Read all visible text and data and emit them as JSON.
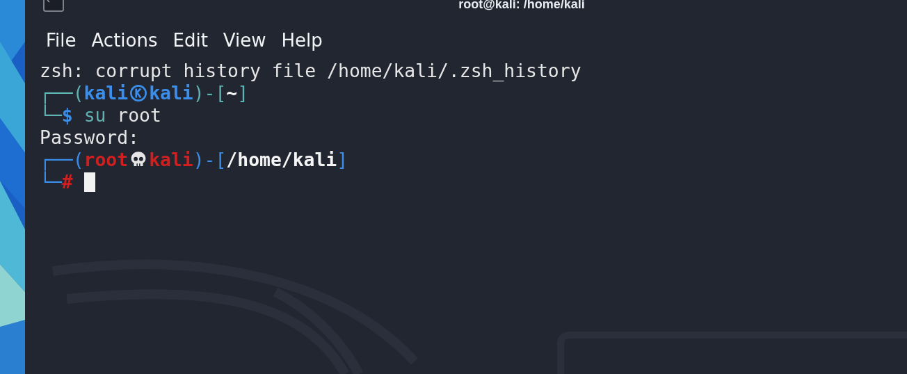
{
  "window": {
    "title": "root@kali: /home/kali"
  },
  "menu": [
    {
      "label": "File"
    },
    {
      "label": "Actions"
    },
    {
      "label": "Edit"
    },
    {
      "label": "View"
    },
    {
      "label": "Help"
    }
  ],
  "lines": [
    {
      "kind": "output",
      "text": "zsh: corrupt history file /home/kali/.zsh_history"
    },
    {
      "kind": "prompt",
      "root": false,
      "corner": "┌──",
      "open": "(",
      "user": "kali",
      "host": "kali",
      "close": ")",
      "sep": "-[",
      "dir": "~",
      "end": "]"
    },
    {
      "kind": "command",
      "root": false,
      "corner": "└─",
      "symbol": "$",
      "program": "su",
      "args": "root"
    },
    {
      "kind": "output",
      "text": "Password:"
    },
    {
      "kind": "prompt",
      "root": true,
      "corner": "┌──",
      "open": "(",
      "user": "root",
      "host": "kali",
      "close": ")",
      "sep": "-[",
      "dir": "/home/kali",
      "end": "]"
    },
    {
      "kind": "command",
      "root": true,
      "corner": "└─",
      "symbol": "#",
      "cursor": true
    }
  ]
}
